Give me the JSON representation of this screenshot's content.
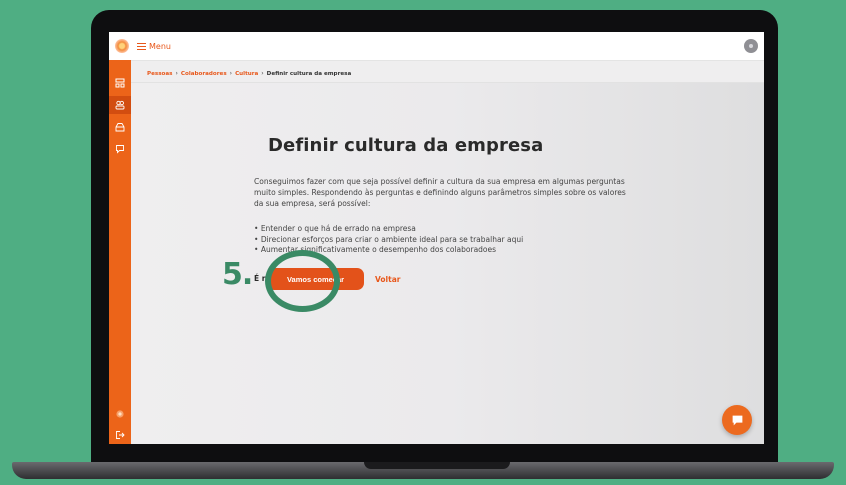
{
  "topbar": {
    "menu_label": "Menu"
  },
  "breadcrumb": {
    "items": [
      "Pessoas",
      "Colaboradores",
      "Cultura"
    ],
    "current": "Definir cultura da empresa",
    "separator": "›"
  },
  "page": {
    "title": "Definir cultura da empresa",
    "intro": "Conseguimos fazer com que seja possível definir a cultura da sua empresa em algumas perguntas muito simples. Respondendo às perguntas e definindo alguns parâmetros simples sobre os valores da sua empresa, será possível:",
    "bullets": [
      "Entender o que há de errado na empresa",
      "Direcionar esforços para criar o ambiente ideal para se trabalhar aqui",
      "Aumentar significativamente o desempenho dos colaboradoes"
    ],
    "cta_text": "É rapidinho!",
    "start_button": "Vamos começar",
    "back_link": "Voltar"
  },
  "annotation": {
    "step": "5."
  },
  "sidebar": {
    "icons": [
      "dashboard-icon",
      "people-icon",
      "box-icon",
      "chat-icon",
      "logo-small-icon",
      "logout-icon"
    ],
    "active_index": 1
  },
  "colors": {
    "brand_orange": "#e8571a",
    "sidebar": "#ec6419",
    "annotation_green": "#3a8a65",
    "background_green": "#4fae83"
  }
}
